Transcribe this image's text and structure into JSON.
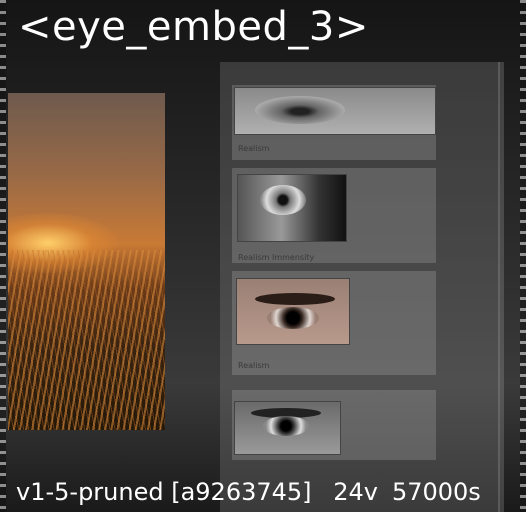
{
  "title": "<eye_embed_3>",
  "footer": {
    "model": "v1-5-pruned [a9263745]",
    "vectors": "24v",
    "steps": "57000s"
  },
  "cards": [
    {
      "caption": "Realism"
    },
    {
      "caption": "Realism Immensity"
    },
    {
      "caption": "Realism"
    }
  ]
}
